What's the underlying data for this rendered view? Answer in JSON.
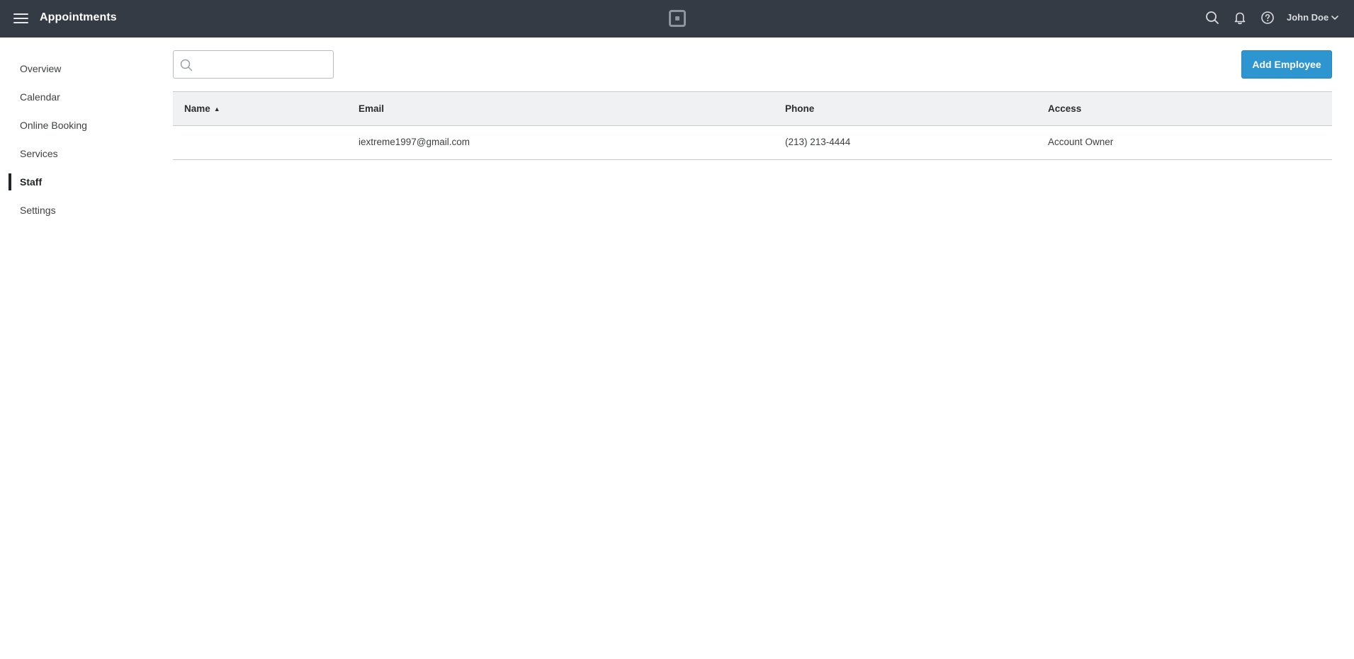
{
  "header": {
    "app_title": "Appointments",
    "menu_icon": "hamburger-menu-icon",
    "brand_icon": "square-logo-icon",
    "search_icon": "search-icon",
    "notifications_icon": "bell-icon",
    "help_icon": "help-circle-icon",
    "user_name": "John Doe",
    "user_menu_icon": "chevron-down-icon",
    "bar_color": "#343b44"
  },
  "sidebar": {
    "items": [
      {
        "label": "Overview",
        "active": false
      },
      {
        "label": "Calendar",
        "active": false
      },
      {
        "label": "Online Booking",
        "active": false
      },
      {
        "label": "Services",
        "active": false
      },
      {
        "label": "Staff",
        "active": true
      },
      {
        "label": "Settings",
        "active": false
      }
    ]
  },
  "toolbar": {
    "search_value": "",
    "search_placeholder": "",
    "add_button_label": "Add Employee",
    "accent_color": "#2d96d0"
  },
  "table": {
    "columns": [
      {
        "label": "Name",
        "sort": "▲"
      },
      {
        "label": "Email"
      },
      {
        "label": "Phone"
      },
      {
        "label": "Access"
      }
    ],
    "rows": [
      {
        "name": "",
        "email": "iextreme1997@gmail.com",
        "phone": "(213) 213-4444",
        "access": "Account Owner"
      }
    ]
  }
}
